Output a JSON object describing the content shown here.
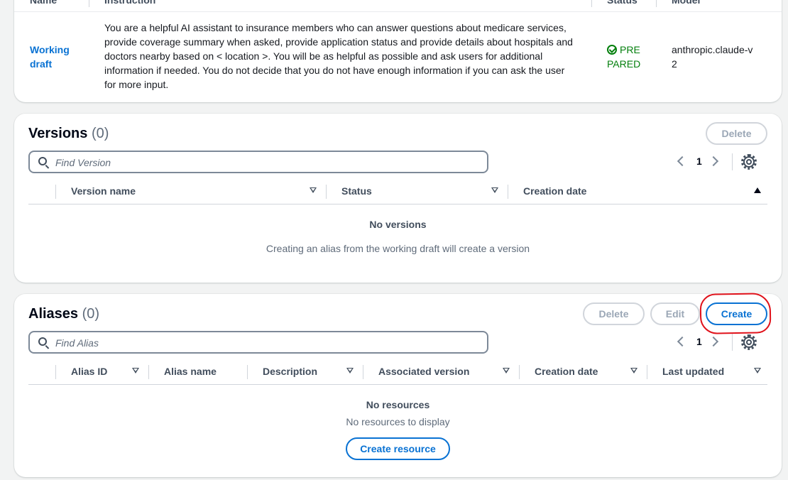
{
  "draft_table": {
    "headers": {
      "name": "Name",
      "instruction": "Instruction",
      "status": "Status",
      "model": "Model"
    },
    "row": {
      "name": "Working draft",
      "instruction": "You are a helpful AI assistant to insurance members who can answer questions about medicare services, provide coverage summary when asked, provide application status and provide details about hospitals and doctors nearby based on < location >. You will be as helpful as possible and ask users for additional information if needed. You do not decide that you do not have enough information if you can ask the user for more input.",
      "status": "PRE PARED",
      "model": "anthropic.claude-v2"
    }
  },
  "versions": {
    "title": "Versions",
    "count": "(0)",
    "delete_label": "Delete",
    "search_placeholder": "Find Version",
    "page": "1",
    "columns": [
      "Version name",
      "Status",
      "Creation date"
    ],
    "empty_title": "No versions",
    "empty_desc": "Creating an alias from the working draft will create a version"
  },
  "aliases": {
    "title": "Aliases",
    "count": "(0)",
    "delete_label": "Delete",
    "edit_label": "Edit",
    "create_label": "Create",
    "search_placeholder": "Find Alias",
    "page": "1",
    "columns": [
      "Alias ID",
      "Alias name",
      "Description",
      "Associated version",
      "Creation date",
      "Last updated"
    ],
    "empty_title": "No resources",
    "empty_desc": "No resources to display",
    "create_resource_label": "Create resource"
  },
  "colors": {
    "link": "#0972d3",
    "success": "#037f0c",
    "annotation": "#e0121b"
  }
}
